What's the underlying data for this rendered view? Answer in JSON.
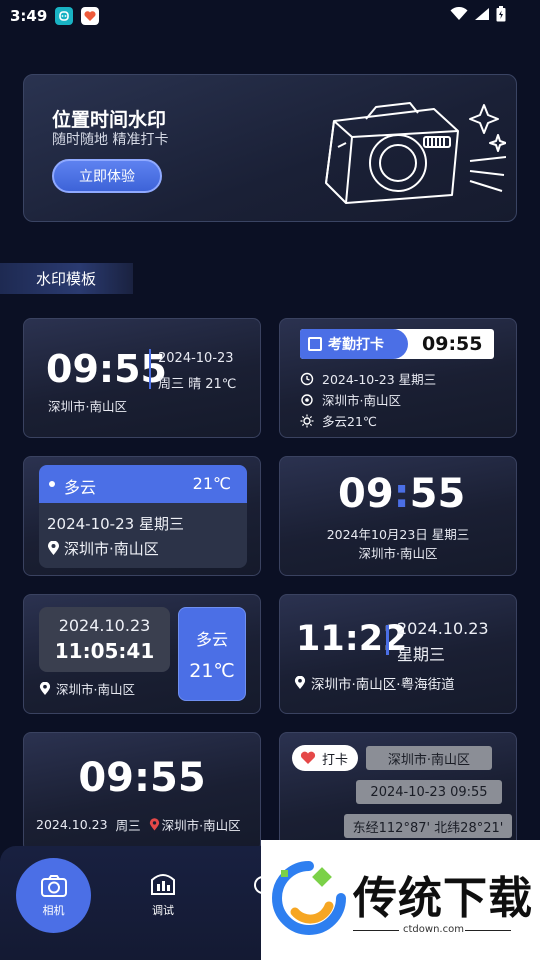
{
  "status_bar": {
    "time": "3:49"
  },
  "hero": {
    "title": "位置时间水印",
    "subtitle": "随时随地 精准打卡",
    "button_label": "立即体验"
  },
  "section": {
    "title": "水印模板"
  },
  "templates": {
    "t1": {
      "time": "09:55",
      "date": "2024-10-23",
      "weekday_weather": "周三  晴  21℃",
      "location": "深圳市·南山区"
    },
    "t2": {
      "badge": "考勤打卡",
      "time": "09:55",
      "datetime": "2024-10-23  星期三",
      "location": "深圳市·南山区",
      "weather": "多云21℃"
    },
    "t3": {
      "weather": "多云",
      "temp": "21℃",
      "date": "2024-10-23  星期三",
      "location": "深圳市·南山区"
    },
    "t4": {
      "time_hh": "09",
      "time_mm": "55",
      "date": "2024年10月23日  星期三",
      "location": "深圳市·南山区"
    },
    "t5": {
      "date": "2024.10.23",
      "time": "11:05:41",
      "weather": "多云",
      "temp": "21℃",
      "location": "深圳市·南山区"
    },
    "t6": {
      "time": "11:22",
      "date": "2024.10.23",
      "weekday": "星期三",
      "location": "深圳市·南山区·粤海街道"
    },
    "t7": {
      "time": "09:55",
      "date": "2024.10.23",
      "weekday": "周三",
      "location": "深圳市·南山区"
    },
    "t8": {
      "tag": "打卡",
      "location": "深圳市·南山区",
      "datetime": "2024-10-23  09:55",
      "coords": "东经112°87'  北纬28°21'"
    }
  },
  "bottom_nav": {
    "camera_label": "相机",
    "tune_label": "调试"
  },
  "watermark": {
    "brand": "传统下载",
    "domain": "ctdown.com"
  },
  "colors": {
    "accent": "#4b6fe6",
    "background": "#0b1024",
    "card": "#1e2438"
  }
}
